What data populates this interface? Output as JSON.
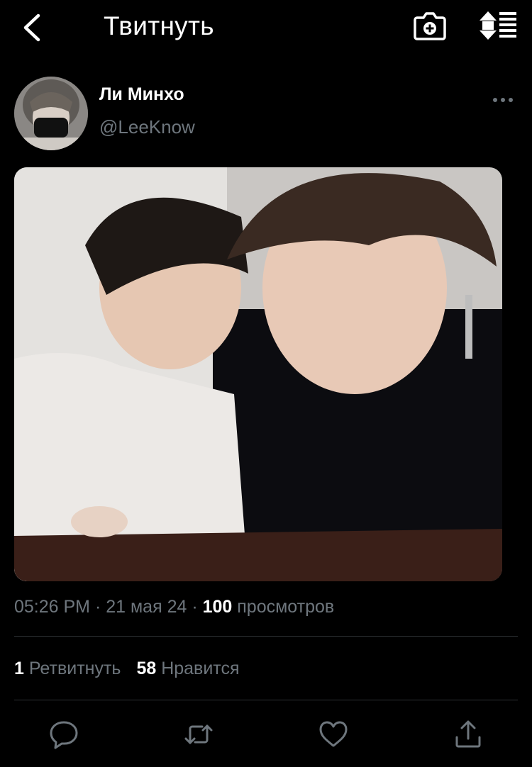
{
  "header": {
    "title": "Твитнуть",
    "back_icon": "chevron-left-icon",
    "camera_icon": "camera-plus-icon",
    "sort_icon": "sort-list-icon"
  },
  "tweet": {
    "display_name": "Ли Минхо",
    "handle": "@LeeKnow",
    "more_icon": "more-horizontal-icon"
  },
  "meta": {
    "time": "05:26 PM",
    "separator1": " · ",
    "date": "21 мая 24",
    "separator2": " · ",
    "views_count": "100",
    "views_label": " просмотров"
  },
  "stats": {
    "retweets_count": "1",
    "retweets_label": " Ретвитнуть",
    "likes_count": "58",
    "likes_label": " Нравится"
  },
  "actions": {
    "reply_icon": "reply-icon",
    "retweet_icon": "retweet-icon",
    "like_icon": "heart-icon",
    "share_icon": "share-icon"
  },
  "colors": {
    "background": "#000000",
    "secondary_text": "#6e767d",
    "divider": "#2f3336"
  }
}
